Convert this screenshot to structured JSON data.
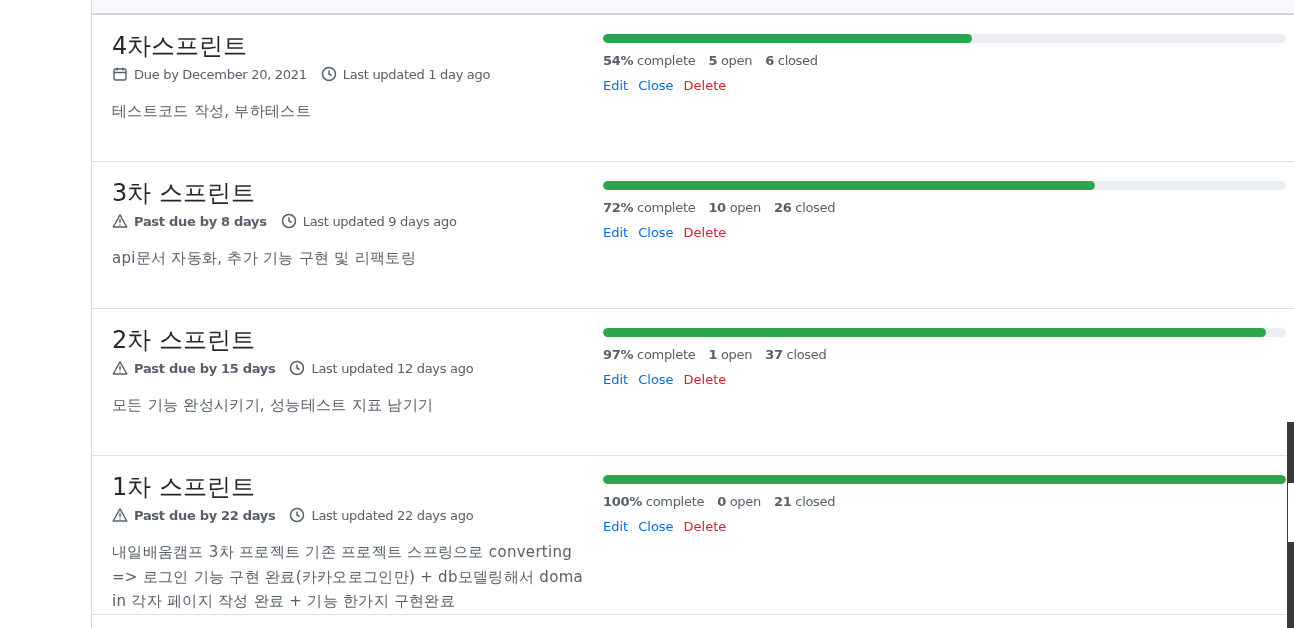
{
  "milestones": [
    {
      "title": "4차스프린트",
      "due": {
        "kind": "due",
        "text": "Due by December 20, 2021"
      },
      "updated": "Last updated 1 day ago",
      "description": "테스트코드 작성, 부하테스트",
      "level": 0.54,
      "stats": [
        "**54%** complete",
        "**5** open",
        "**6** closed"
      ],
      "actions": [
        "Edit",
        "Close",
        "Delete"
      ]
    },
    {
      "title": "3차 스프린트",
      "due": {
        "kind": "past_due",
        "text": "Past due by 8 days"
      },
      "updated": "Last updated 9 days ago",
      "description": "api문서 자동화, 추가 기능 구현 및 리팩토링",
      "level": 0.72,
      "stats": [
        "**72%** complete",
        "**10** open",
        "**26** closed"
      ],
      "actions": [
        "Edit",
        "Close",
        "Delete"
      ]
    },
    {
      "title": "2차 스프린트",
      "due": {
        "kind": "past_due",
        "text": "Past due by 15 days"
      },
      "updated": "Last updated 12 days ago",
      "description": "모든 기능 완성시키기, 성능테스트 지표 남기기",
      "level": 0.97,
      "stats": [
        "**97%** complete",
        "**1** open",
        "**37** closed"
      ],
      "actions": [
        "Edit",
        "Close",
        "Delete"
      ]
    },
    {
      "title": "1차 스프린트",
      "due": {
        "kind": "past_due",
        "text": "Past due by 22 days"
      },
      "updated": "Last updated 22 days ago",
      "description": "내일배움캠프 3차 프로젝트 기존 프로젝트 스프링으로 converting => 로그인 기능 구현 완료(카카오로그인만) + db모델링해서 domain 각자 페이지 작성 완료 + 기능 한가지 구현완료",
      "level": 1,
      "stats": [
        "**100%** complete",
        "**0** open",
        "**21** closed"
      ],
      "actions": [
        "Edit",
        "Close",
        "Delete"
      ]
    }
  ]
}
